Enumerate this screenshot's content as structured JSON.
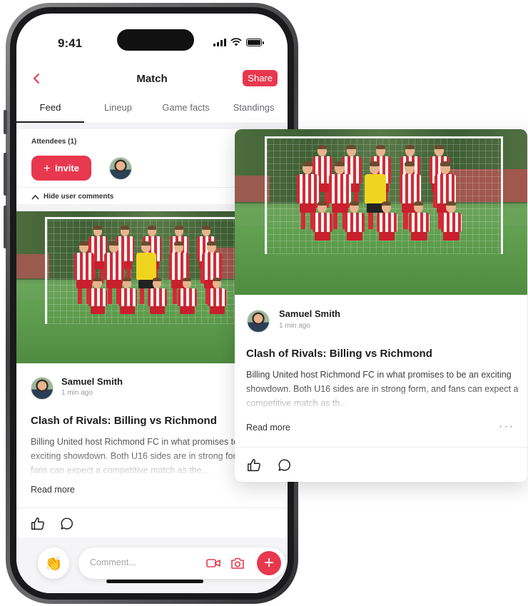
{
  "status_bar": {
    "time": "9:41"
  },
  "header": {
    "title": "Match",
    "share_label": "Share"
  },
  "tabs": [
    {
      "label": "Feed",
      "active": true
    },
    {
      "label": "Lineup",
      "active": false
    },
    {
      "label": "Game facts",
      "active": false
    },
    {
      "label": "Standings",
      "active": false
    }
  ],
  "attendees": {
    "label": "Attendees (1)",
    "invite_label": "Invite"
  },
  "hide_comments_label": "Hide user comments",
  "post": {
    "author": "Samuel Smith",
    "time": "1 min ago",
    "title": "Clash of Rivals: Billing vs Richmond",
    "body_phone": "Billing United host Richmond FC in what promises to be an exciting showdown. Both U16 sides are in strong form, and fans can expect a competitive match as the...",
    "body_card": "Billing United host Richmond FC in what promises to be an exciting showdown. Both U16 sides are in strong form, and fans can expect a competitive match as th...",
    "read_more": "Read more"
  },
  "comment_bar": {
    "placeholder": "Comment..."
  },
  "icons": {
    "back": "chevron-left-icon",
    "like": "thumbs-up-icon",
    "comment": "comment-bubble-icon",
    "emoji": "clapping-hands-icon",
    "video": "video-camera-icon",
    "camera": "camera-icon",
    "add": "plus-icon",
    "more": "more-dots-icon"
  },
  "colors": {
    "accent": "#e8384f",
    "text": "#1d1d1f",
    "muted": "#9a9aa0"
  }
}
